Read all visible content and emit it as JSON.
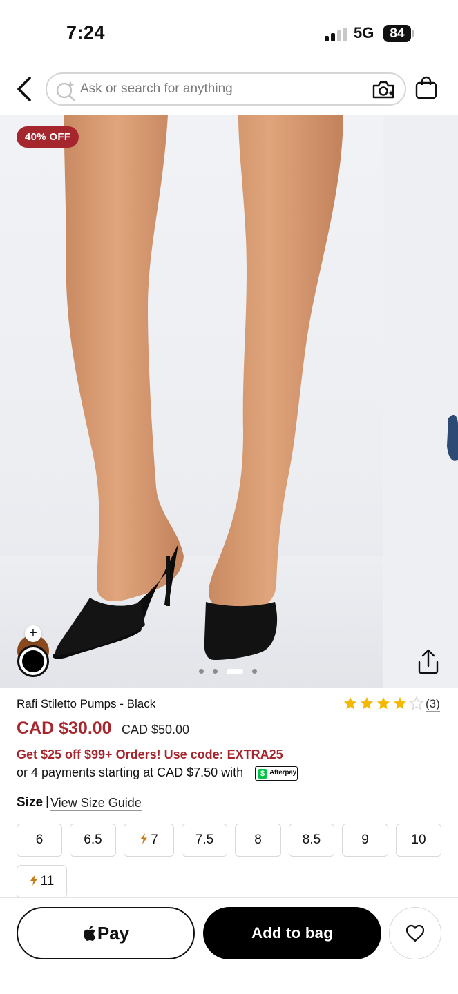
{
  "status_bar": {
    "time": "7:24",
    "network": "5G",
    "battery": "84"
  },
  "search": {
    "placeholder": "Ask or search for anything"
  },
  "icons": {
    "back": "chevron-left-icon",
    "search": "ai-search-icon",
    "camera": "camera-icon",
    "bag": "shopping-bag-icon",
    "share": "share-icon",
    "wishlist": "heart-icon",
    "apple": "apple-logo-icon"
  },
  "gallery": {
    "badge": "40% OFF",
    "image_count": 4,
    "active_index": 2,
    "swatches": [
      "brown",
      "black"
    ],
    "selected_swatch": "black"
  },
  "product": {
    "name": "Rafi Stiletto Pumps - Black",
    "rating": 4,
    "rating_max": 5,
    "review_count": "(3)",
    "price_sale": "CAD $30.00",
    "price_original": "CAD $50.00",
    "promo": "Get $25 off $99+ Orders! Use code: EXTRA25",
    "afterpay_text": "or 4 payments starting at CAD $7.50 with",
    "afterpay_badge": "Afterpay"
  },
  "sizes": {
    "label": "Size",
    "separator": "|",
    "guide_link": "View Size Guide",
    "options": [
      {
        "label": "6",
        "flash": false
      },
      {
        "label": "6.5",
        "flash": false
      },
      {
        "label": "7",
        "flash": true
      },
      {
        "label": "7.5",
        "flash": false
      },
      {
        "label": "8",
        "flash": false
      },
      {
        "label": "8.5",
        "flash": false
      },
      {
        "label": "9",
        "flash": false
      },
      {
        "label": "10",
        "flash": false
      },
      {
        "label": "11",
        "flash": true
      }
    ]
  },
  "actions": {
    "apple_pay_label": "Pay",
    "add_to_bag_label": "Add to bag"
  },
  "colors": {
    "accent": "#a6262e",
    "star": "#f5b800",
    "flash": "#c97a12"
  }
}
